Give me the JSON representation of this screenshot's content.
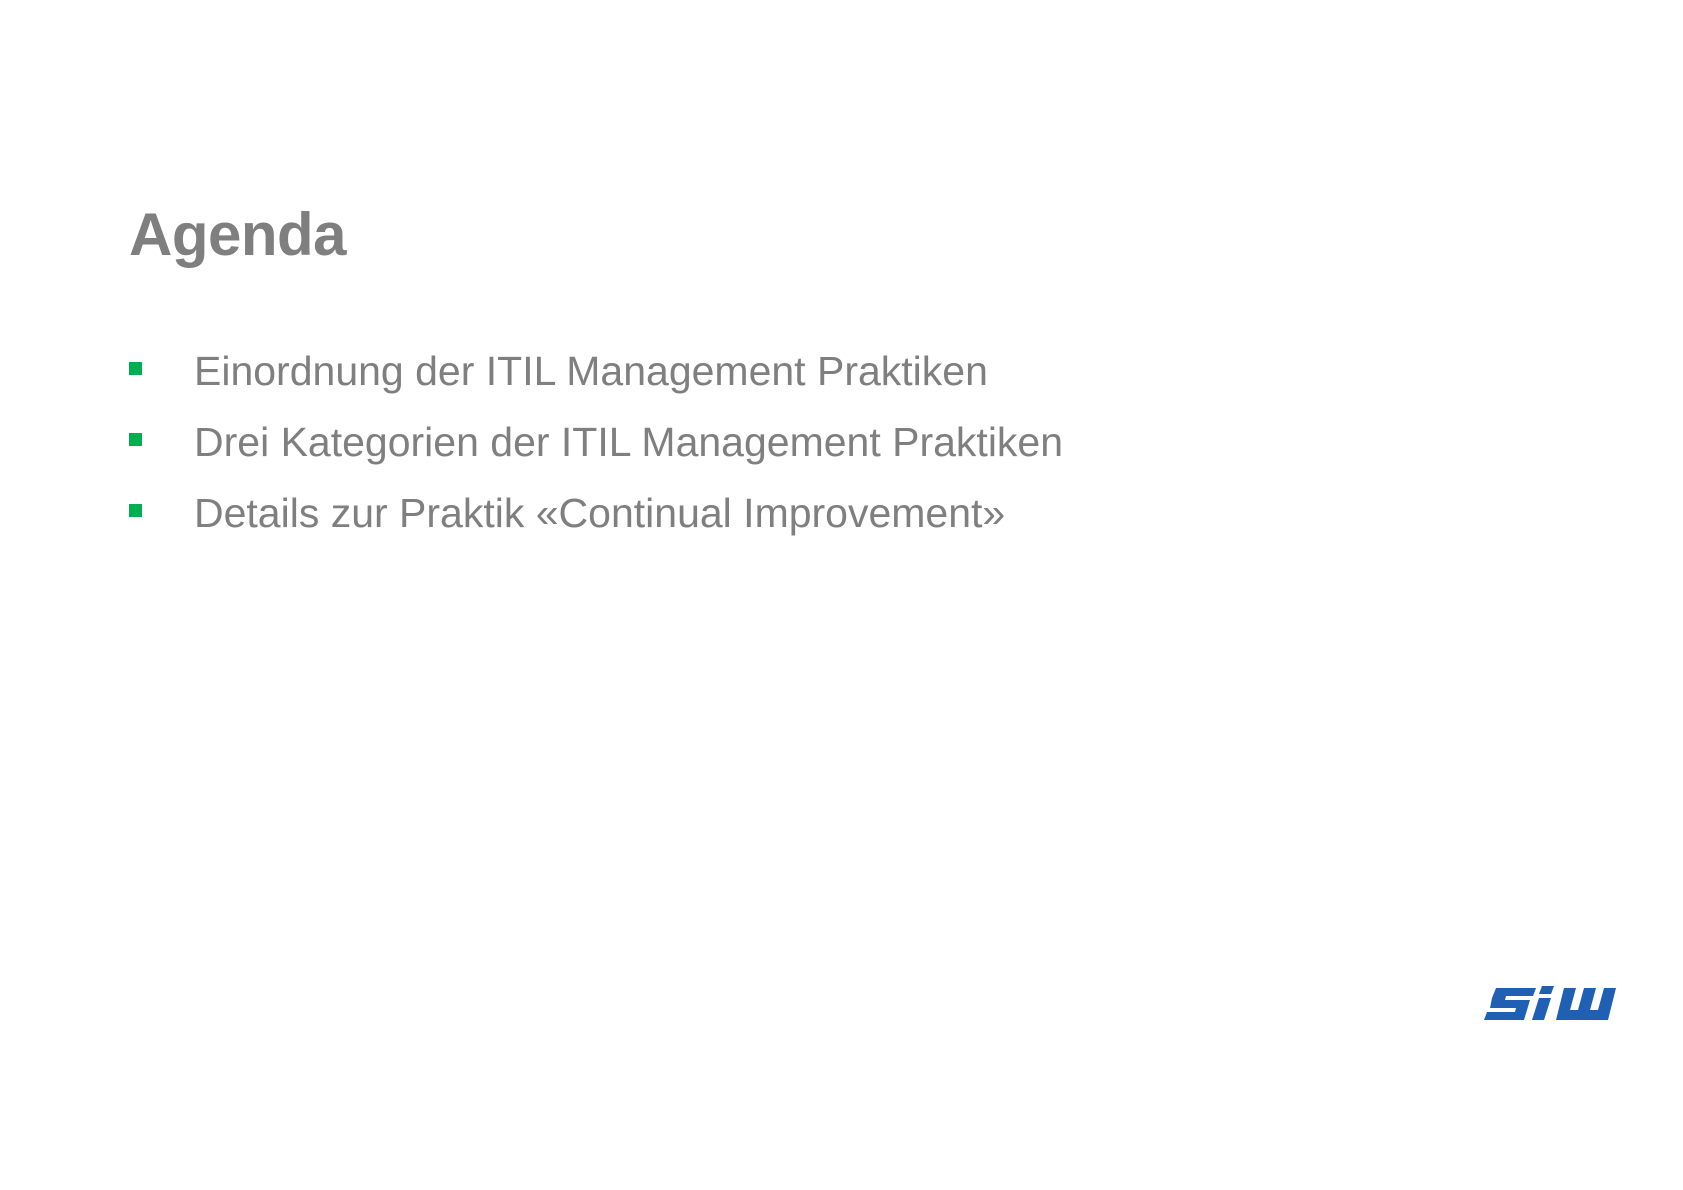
{
  "slide": {
    "title": "Agenda",
    "items": [
      {
        "label": "Einordnung der ITIL Management Praktiken"
      },
      {
        "label": "Drei Kategorien der ITIL Management Praktiken"
      },
      {
        "label": "Details zur Praktik «Continual Improvement»"
      }
    ],
    "bullet_icon": "square-bullet-icon",
    "bullet_color": "#00b050",
    "text_color": "#7f7f7f"
  },
  "logo": {
    "text": "SIW",
    "color": "#1f5fb4"
  }
}
